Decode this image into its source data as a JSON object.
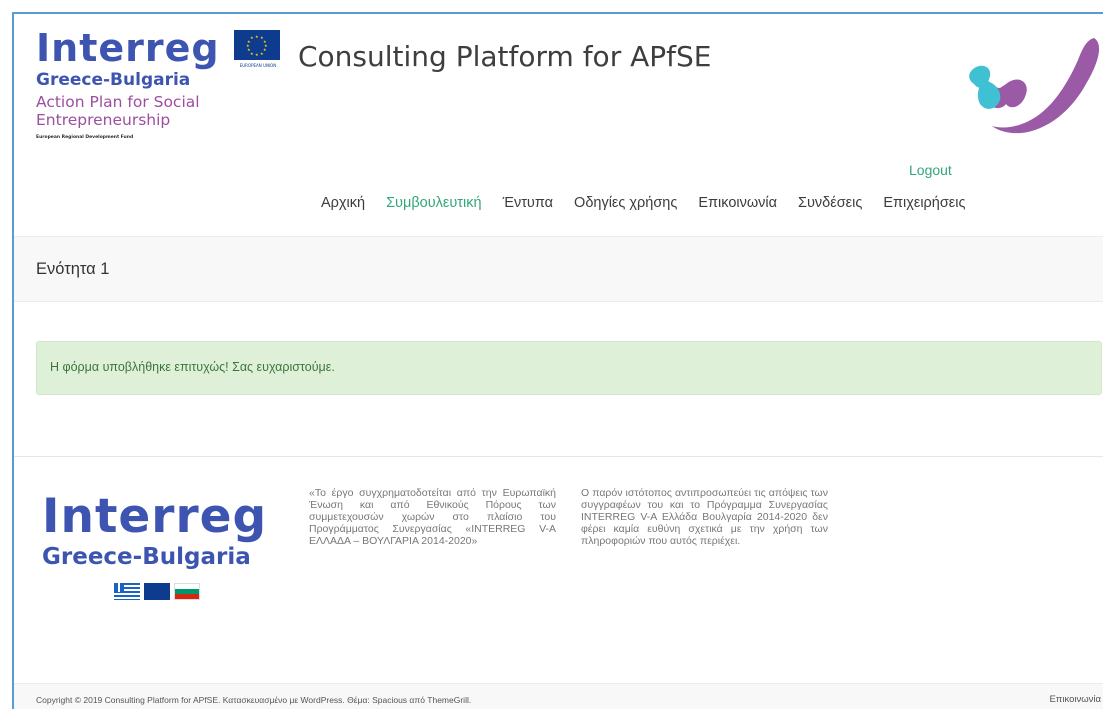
{
  "header": {
    "logo": {
      "brand": "Interreg",
      "region": "Greece-Bulgaria",
      "tagline_line1": "Action Plan for Social",
      "tagline_line2": "Entrepreneurship",
      "fund": "European Regional Development Fund"
    },
    "eu_flag_label": "EUROPEAN UNION",
    "site_title": "Consulting Platform for APfSE",
    "logout_label": "Logout",
    "nav": [
      {
        "label": "Αρχική",
        "active": false
      },
      {
        "label": "Συμβουλευτική",
        "active": true
      },
      {
        "label": "Έντυπα",
        "active": false
      },
      {
        "label": "Οδηγίες χρήσης",
        "active": false
      },
      {
        "label": "Επικοινωνία",
        "active": false
      },
      {
        "label": "Συνδέσεις",
        "active": false
      },
      {
        "label": "Επιχειρήσεις",
        "active": false
      }
    ]
  },
  "page": {
    "title": "Ενότητα 1",
    "alert_message": "Η φόρμα υποβλήθηκε επιτυχώς! Σας ευχαριστούμε."
  },
  "footer": {
    "logo": {
      "brand": "Interreg",
      "region": "Greece-Bulgaria"
    },
    "text1": "«Το έργο συγχρηματοδοτείται από την Ευρωπαϊκή Ένωση και από Εθνικούς Πόρους των συμμετεχουσών χωρών στο πλαίσιο του Προγράμματος Συνεργασίας «INTERREG V-A ΕΛΛΑΔΑ – ΒΟΥΛΓΑΡΙΑ 2014-2020»",
    "text2": "Ο παρόν ιστότοπος αντιπροσωπεύει τις απόψεις των συγγραφέων του και το Πρόγραμμα Συνεργασίας INTERREG V-A Ελλάδα Βουλγαρία 2014-2020 δεν φέρει καμία ευθύνη σχετικά με την χρήση των πληροφοριών που αυτός περιέχει.",
    "copyright": "Copyright © 2019 Consulting Platform for APfSE. Κατασκευασμένο με WordPress. Θέμα: Spacious από ThemeGrill.",
    "bottom_link": "Επικοινωνία"
  },
  "colors": {
    "accent_green": "#33a77a",
    "interreg_blue": "#3d55b1",
    "tagline_purple": "#9c4ea0",
    "alert_bg": "#dff0d8",
    "alert_text": "#3c763d",
    "frame_border": "#5b9bd5"
  },
  "icons": [
    "eu-flag-icon",
    "brand-figure-icon",
    "greek-flag-icon",
    "bulgarian-flag-icon"
  ]
}
